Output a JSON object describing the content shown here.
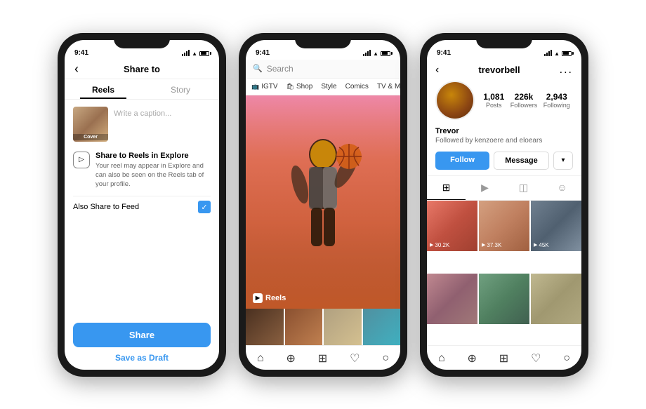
{
  "phones": {
    "phone1": {
      "status": {
        "time": "9:41"
      },
      "header": {
        "title": "Share to",
        "back": "‹"
      },
      "tabs": [
        {
          "label": "Reels",
          "active": true
        },
        {
          "label": "Story",
          "active": false
        }
      ],
      "caption_placeholder": "Write a caption...",
      "cover_label": "Cover",
      "share_explore": {
        "title": "Share to Reels in Explore",
        "desc": "Your reel may appear in Explore and can also be seen on the Reels tab of your profile."
      },
      "also_feed_label": "Also Share to Feed",
      "share_btn": "Share",
      "draft_btn": "Save as Draft"
    },
    "phone2": {
      "status": {
        "time": "9:41"
      },
      "search_placeholder": "Search",
      "categories": [
        "IGTV",
        "Shop",
        "Style",
        "Comics",
        "TV & Movie"
      ],
      "reels_label": "Reels",
      "nav_icons": [
        "home",
        "search",
        "plus",
        "heart",
        "person"
      ]
    },
    "phone3": {
      "status": {
        "time": "9:41"
      },
      "header": {
        "back": "‹",
        "username": "trevorbell",
        "more": "..."
      },
      "stats": [
        {
          "value": "1,081",
          "label": "Posts"
        },
        {
          "value": "226k",
          "label": "Followers"
        },
        {
          "value": "2,943",
          "label": "Following"
        }
      ],
      "name": "Trevor",
      "followed_by": "Followed by kenzoere and eloears",
      "follow_btn": "Follow",
      "message_btn": "Message",
      "dropdown": "▾",
      "content_tabs": [
        "grid",
        "reels",
        "igtv",
        "tagged"
      ],
      "cell_plays": [
        "▶ 30.2K",
        "▶ 37.3K",
        "▶ 45K"
      ],
      "nav_icons": [
        "home",
        "search",
        "plus",
        "heart",
        "person"
      ]
    }
  }
}
